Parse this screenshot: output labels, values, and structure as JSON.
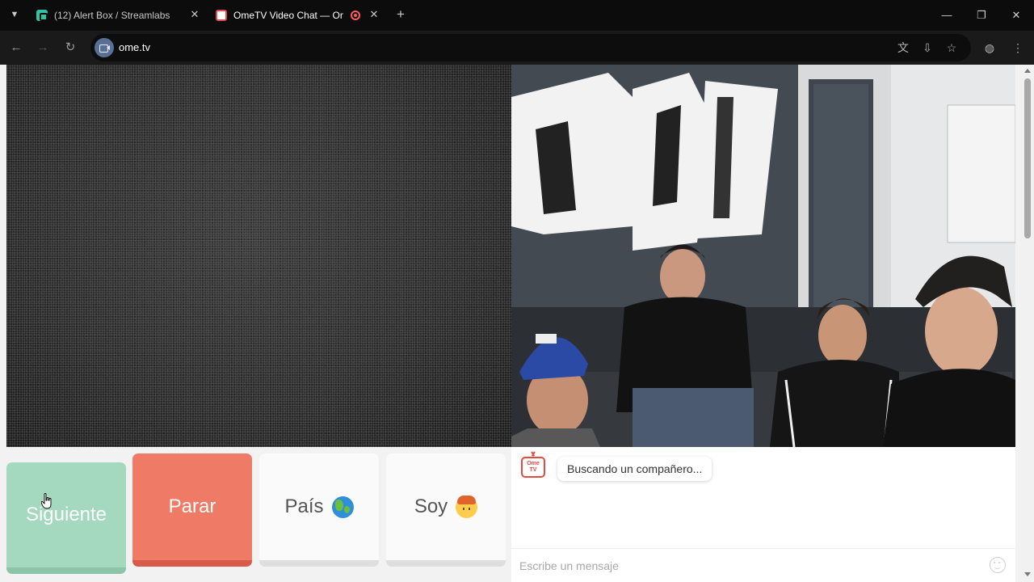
{
  "browser": {
    "tabs": [
      {
        "title": "(12) Alert Box / Streamlabs",
        "favicon": "streamlabs-icon",
        "active": false
      },
      {
        "title": "OmeTV Video Chat — Ome",
        "favicon": "ometv-icon",
        "active": true,
        "recording": true
      }
    ],
    "url": "ome.tv",
    "colors": {
      "tabbar": "#0c0c0c",
      "toolbar": "#1a1a1a",
      "omnibox": "#0d0d0d"
    }
  },
  "controls": {
    "next_label": "Siguiente",
    "stop_label": "Parar",
    "country_label": "País",
    "country_icon": "globe-icon",
    "gender_label": "Soy",
    "gender_icon": "boy-icon",
    "colors": {
      "next": "#a4d8bf",
      "stop": "#ef7a66",
      "neutral": "#fafafa"
    }
  },
  "chat": {
    "logo_text": "Ome TV",
    "status_message": "Buscando un compañero...",
    "input_placeholder": "Escribe un mensaje",
    "emoji_icon": "smile-icon"
  },
  "video": {
    "local_state": "static-noise",
    "remote_state": "connected-stream"
  }
}
